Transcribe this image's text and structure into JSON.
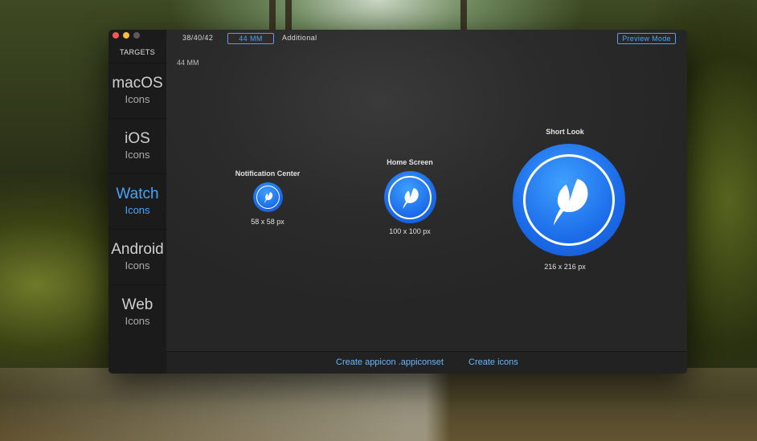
{
  "window": {
    "traffic_lights": [
      "close",
      "minimize",
      "zoom"
    ],
    "colors": {
      "close": "#ee5a52",
      "minimize": "#f5be3b",
      "zoom": "#5a5a5a",
      "accent": "#4ba3f7"
    }
  },
  "sidebar": {
    "header": "TARGETS",
    "items": [
      {
        "title": "macOS",
        "subtitle": "Icons",
        "active": false
      },
      {
        "title": "iOS",
        "subtitle": "Icons",
        "active": false
      },
      {
        "title": "Watch",
        "subtitle": "Icons",
        "active": true
      },
      {
        "title": "Android",
        "subtitle": "Icons",
        "active": false
      },
      {
        "title": "Web",
        "subtitle": "Icons",
        "active": false
      }
    ]
  },
  "toolbar": {
    "tabs": [
      {
        "label": "38/40/42",
        "selected": false
      },
      {
        "label": "44 MM",
        "selected": true
      },
      {
        "label": "Additional",
        "selected": false
      }
    ],
    "preview_label": "Preview Mode"
  },
  "main": {
    "size_caption": "44 MM",
    "icons": [
      {
        "title": "Notification Center",
        "size_label": "58 x 58 px",
        "icon": "feather-icon"
      },
      {
        "title": "Home Screen",
        "size_label": "100 x 100 px",
        "icon": "feather-icon"
      },
      {
        "title": "Short Look",
        "size_label": "216 x 216 px",
        "icon": "feather-icon"
      }
    ]
  },
  "footer": {
    "create_appicon_label": "Create appicon .appiconset",
    "create_icons_label": "Create icons"
  }
}
